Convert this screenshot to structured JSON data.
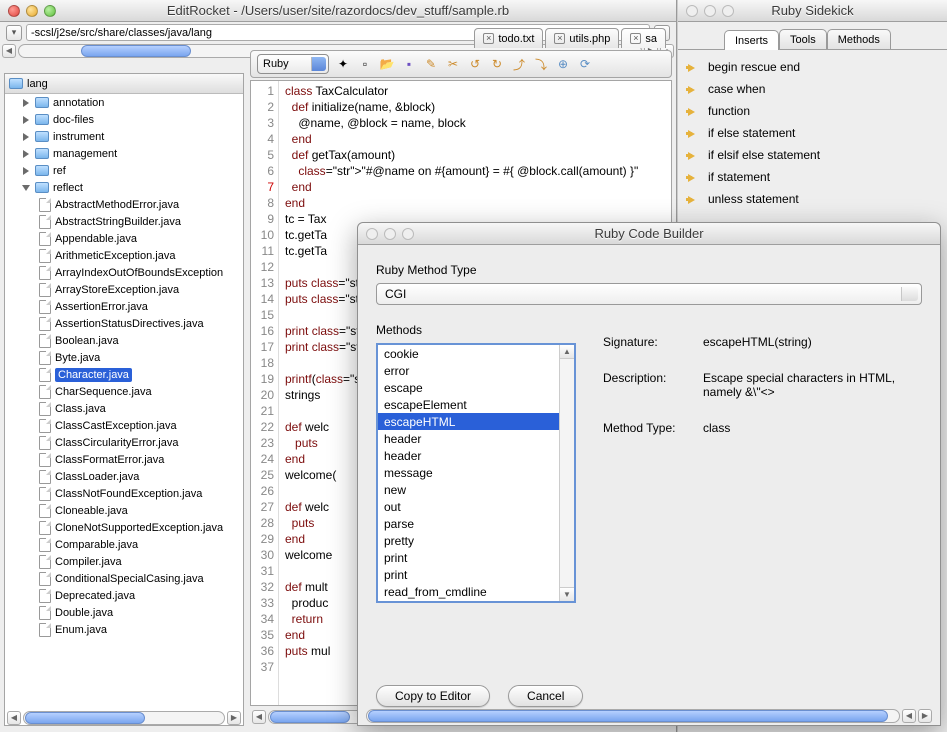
{
  "main_window": {
    "title": "EditRocket - /Users/user/site/razordocs/dev_stuff/sample.rb"
  },
  "sidekick_window": {
    "title": "Ruby Sidekick"
  },
  "path_field": "-scsl/j2se/src/share/classes/java/lang",
  "tree_root": "lang",
  "tree_folders": [
    "annotation",
    "doc-files",
    "instrument",
    "management",
    "ref",
    "reflect"
  ],
  "tree_files": [
    "AbstractMethodError.java",
    "AbstractStringBuilder.java",
    "Appendable.java",
    "ArithmeticException.java",
    "ArrayIndexOutOfBoundsException",
    "ArrayStoreException.java",
    "AssertionError.java",
    "AssertionStatusDirectives.java",
    "Boolean.java",
    "Byte.java",
    "Character.java",
    "CharSequence.java",
    "Class.java",
    "ClassCastException.java",
    "ClassCircularityError.java",
    "ClassFormatError.java",
    "ClassLoader.java",
    "ClassNotFoundException.java",
    "Cloneable.java",
    "CloneNotSupportedException.java",
    "Comparable.java",
    "Compiler.java",
    "ConditionalSpecialCasing.java",
    "Deprecated.java",
    "Double.java",
    "Enum.java"
  ],
  "tree_selected": "Character.java",
  "tabs": [
    {
      "label": "todo.txt",
      "active": false
    },
    {
      "label": "utils.php",
      "active": false
    },
    {
      "label": "sa",
      "active": true
    }
  ],
  "language": "Ruby",
  "code_lines": [
    "class TaxCalculator",
    "  def initialize(name, &block)",
    "    @name, @block = name, block",
    "  end",
    "  def getTax(amount)",
    "    \"#@name on #{amount} = #{ @block.call(amount) }\"",
    "  end",
    "end",
    "tc = Tax",
    "tc.getTa",
    "tc.getTa",
    "",
    "puts \"pu",
    "puts \" w",
    "",
    "print \"p",
    "print \" ",
    "",
    "printf(\"",
    "strings ",
    "",
    "def welc",
    "   puts ",
    "end",
    "welcome(",
    "",
    "def welc",
    "  puts  ",
    "end",
    "welcome ",
    "",
    "def mult",
    "  produc",
    "  return",
    "end",
    "puts mul",
    ""
  ],
  "sidekick": {
    "tabs": [
      "Inserts",
      "Tools",
      "Methods"
    ],
    "active_tab": "Inserts",
    "items": [
      "begin rescue end",
      "case when",
      "function",
      "if else statement",
      "if elsif else statement",
      "if statement",
      "unless statement"
    ]
  },
  "dialog": {
    "title": "Ruby Code Builder",
    "type_label": "Ruby Method Type",
    "type_value": "CGI",
    "methods_label": "Methods",
    "methods": [
      "cookie",
      "error",
      "escape",
      "escapeElement",
      "escapeHTML",
      "header",
      "header",
      "message",
      "new",
      "out",
      "parse",
      "pretty",
      "print",
      "print",
      "read_from_cmdline"
    ],
    "selected_method": "escapeHTML",
    "signature_label": "Signature:",
    "signature_value": "escapeHTML(string)",
    "description_label": "Description:",
    "description_value": "Escape special characters in HTML, namely &\\\"<>",
    "methodtype_label": "Method Type:",
    "methodtype_value": "class",
    "copy_btn": "Copy to Editor",
    "cancel_btn": "Cancel"
  }
}
